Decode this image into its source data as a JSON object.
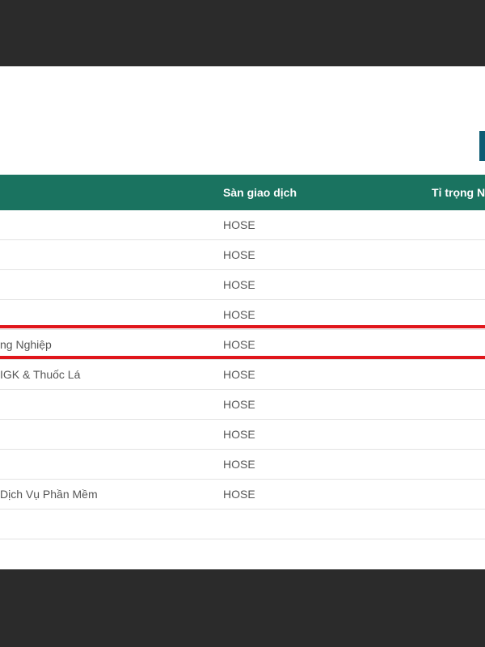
{
  "table": {
    "columns": {
      "exchange": "Sàn giao dịch",
      "weight": "Tỉ trọng N"
    },
    "rows": [
      {
        "industry": "",
        "exchange": "HOSE"
      },
      {
        "industry": "",
        "exchange": "HOSE"
      },
      {
        "industry": "",
        "exchange": "HOSE"
      },
      {
        "industry": "",
        "exchange": "HOSE"
      },
      {
        "industry": "ng Nghiệp",
        "exchange": "HOSE"
      },
      {
        "industry": "IGK & Thuốc Lá",
        "exchange": "HOSE"
      },
      {
        "industry": "",
        "exchange": "HOSE"
      },
      {
        "industry": "",
        "exchange": "HOSE"
      },
      {
        "industry": "",
        "exchange": "HOSE"
      },
      {
        "industry": "Dịch Vụ Phần Mềm",
        "exchange": "HOSE"
      },
      {
        "industry": "",
        "exchange": ""
      }
    ]
  },
  "colors": {
    "header_bg": "#1a7360",
    "highlight_border": "#e0161b",
    "frame_bg": "#2b2b2b",
    "corner_button": "#0d5c73"
  }
}
